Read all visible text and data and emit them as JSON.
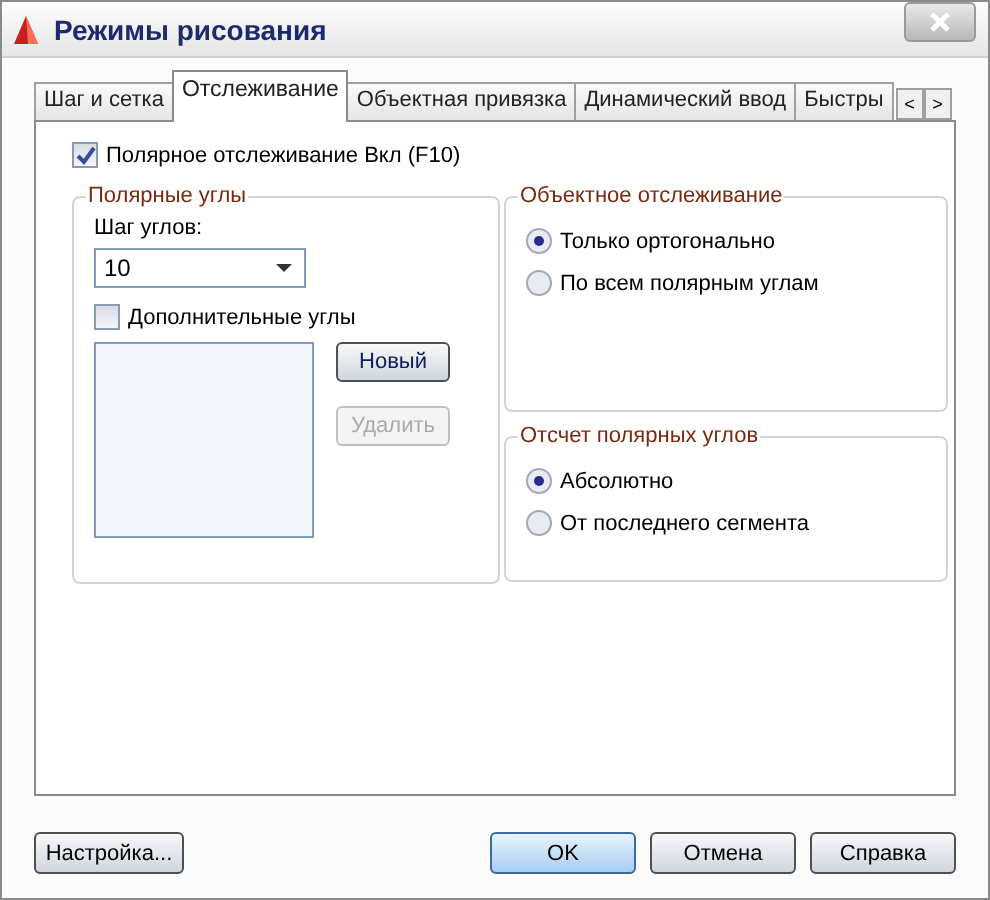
{
  "window": {
    "title": "Режимы рисования"
  },
  "tabs": [
    {
      "label": "Шаг и сетка",
      "selected": false
    },
    {
      "label": "Отслеживание",
      "selected": true
    },
    {
      "label": "Объектная привязка",
      "selected": false
    },
    {
      "label": "Динамический ввод",
      "selected": false
    },
    {
      "label": "Быстры",
      "selected": false
    }
  ],
  "tab_scroll": [
    "<",
    ">"
  ],
  "polar_tracking": {
    "label": "Полярное отслеживание Вкл (F10)",
    "checked": true
  },
  "polar_angles": {
    "title": "Полярные углы",
    "increment_label": "Шаг углов:",
    "increment_value": "10",
    "additional": {
      "label": "Дополнительные углы",
      "checked": false
    },
    "buttons": [
      {
        "label": "Новый",
        "disabled": false
      },
      {
        "label": "Удалить",
        "disabled": true
      }
    ]
  },
  "object_tracking": {
    "title": "Объектное отслеживание",
    "options": [
      {
        "label": "Только ортогонально",
        "selected": true
      },
      {
        "label": "По всем полярным углам",
        "selected": false
      }
    ]
  },
  "angle_measurement": {
    "title": "Отсчет полярных углов",
    "options": [
      {
        "label": "Абсолютно",
        "selected": true
      },
      {
        "label": "От последнего сегмента",
        "selected": false
      }
    ]
  },
  "footer": {
    "options_button": "Настройка...",
    "buttons": [
      {
        "label": "OK",
        "default": true
      },
      {
        "label": "Отмена",
        "default": false
      },
      {
        "label": "Справка",
        "default": false
      }
    ]
  }
}
